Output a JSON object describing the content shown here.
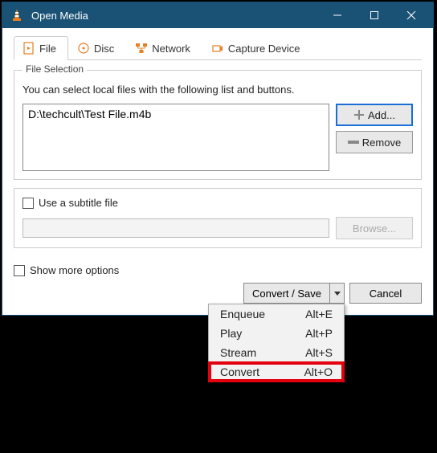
{
  "window": {
    "title": "Open Media"
  },
  "tabs": {
    "file": "File",
    "disc": "Disc",
    "network": "Network",
    "capture": "Capture Device"
  },
  "fileSelection": {
    "legend": "File Selection",
    "hint": "You can select local files with the following list and buttons.",
    "files": [
      "D:\\techcult\\Test File.m4b"
    ],
    "add": "Add...",
    "remove": "Remove"
  },
  "subtitle": {
    "checkbox": "Use a subtitle file",
    "browse": "Browse..."
  },
  "showMore": "Show more options",
  "actions": {
    "convertSave": "Convert / Save",
    "cancel": "Cancel"
  },
  "menu": {
    "items": [
      {
        "label": "Enqueue",
        "shortcut": "Alt+E"
      },
      {
        "label": "Play",
        "shortcut": "Alt+P"
      },
      {
        "label": "Stream",
        "shortcut": "Alt+S"
      },
      {
        "label": "Convert",
        "shortcut": "Alt+O"
      }
    ]
  }
}
